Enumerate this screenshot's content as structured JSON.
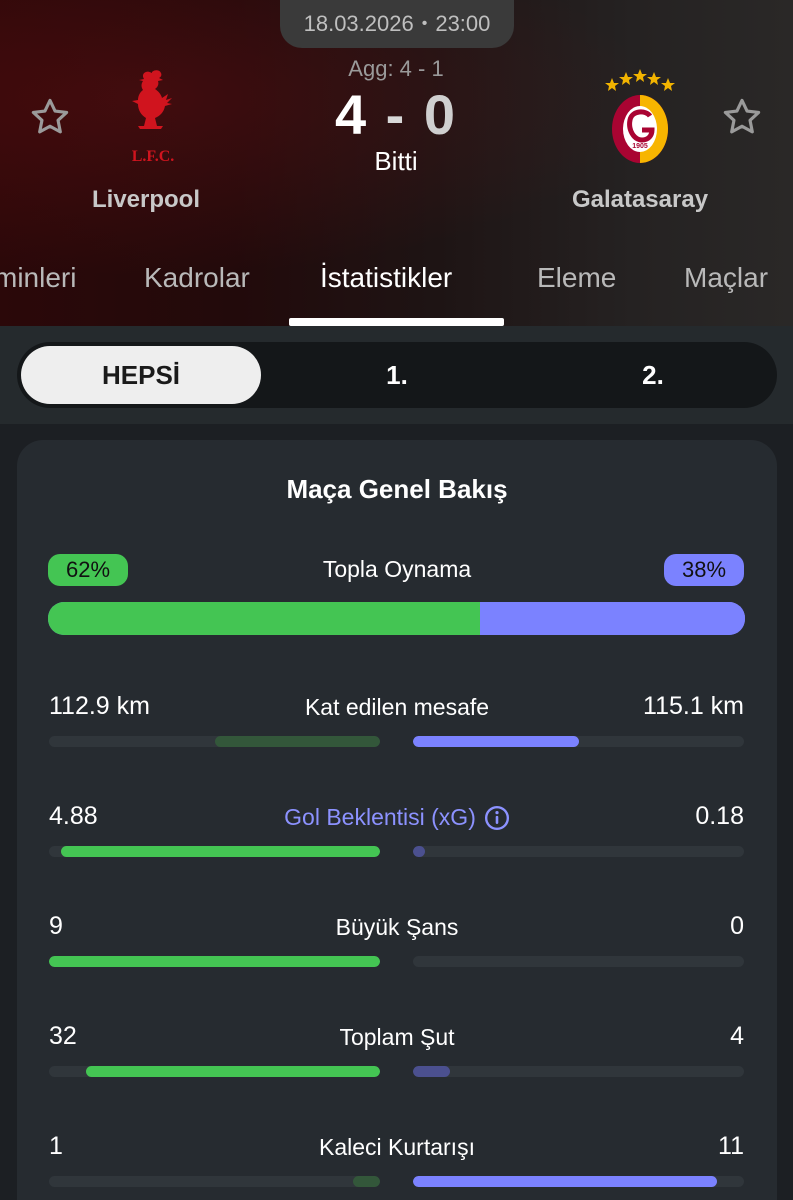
{
  "match": {
    "date": "18.03.2026",
    "separator": "•",
    "time": "23:00",
    "aggregate": "Agg: 4 - 1",
    "home_score": "4",
    "dash": "-",
    "away_score": "0",
    "status": "Bitti",
    "home_team": "Liverpool",
    "away_team": "Galatasaray",
    "home_logo_text": "L.F.C.",
    "away_logo_text": "1905"
  },
  "tabs": [
    {
      "label": "minleri"
    },
    {
      "label": "Kadrolar"
    },
    {
      "label": "İstatistikler",
      "active": true
    },
    {
      "label": "Eleme"
    },
    {
      "label": "Maçlar"
    }
  ],
  "periods": [
    {
      "label": "HEPSİ",
      "active": true
    },
    {
      "label": "1."
    },
    {
      "label": "2."
    }
  ],
  "card": {
    "title": "Maça Genel Bakış",
    "possession": {
      "label": "Topla Oynama",
      "home_text": "62%",
      "away_text": "38%",
      "home_fraction": 0.62,
      "away_fraction": 0.38
    },
    "stats": [
      {
        "label": "Kat edilen mesafe",
        "home": "112.9 km",
        "away": "115.1 km",
        "home_fill": 0.5,
        "away_fill": 0.5,
        "home_muted": true,
        "link": false
      },
      {
        "label": "Gol Beklentisi (xG)",
        "home": "4.88",
        "away": "0.18",
        "home_fill": 0.964,
        "away_fill": 0.036,
        "link": true
      },
      {
        "label": "Büyük Şans",
        "home": "9",
        "away": "0",
        "home_fill": 1.0,
        "away_fill": 0.0,
        "link": false
      },
      {
        "label": "Toplam Şut",
        "home": "32",
        "away": "4",
        "home_fill": 0.889,
        "away_fill": 0.111,
        "link": false
      },
      {
        "label": "Kaleci Kurtarışı",
        "home": "1",
        "away": "11",
        "home_fill": 0.083,
        "away_fill": 0.917,
        "home_muted": true,
        "link": false
      }
    ]
  },
  "colors": {
    "home": "#44c553",
    "home_muted": "#33573a",
    "away": "#7b82ff",
    "track": "#30363b",
    "card": "#262b30",
    "background": "#1c1f23"
  },
  "icons": {
    "favorite": "star-outline-icon",
    "info": "info-circle-icon"
  }
}
